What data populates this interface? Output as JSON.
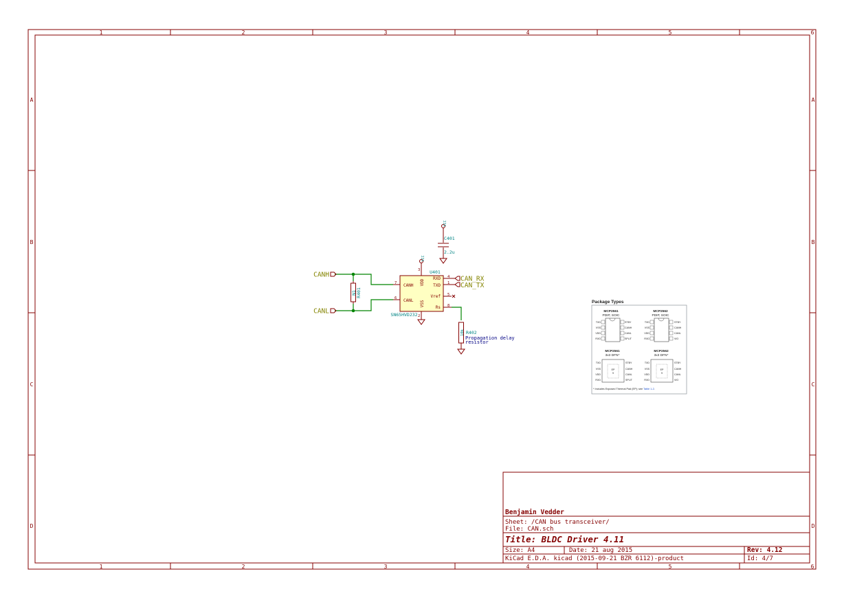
{
  "frame": {
    "columns": [
      "1",
      "2",
      "3",
      "4",
      "5",
      "6"
    ],
    "rows": [
      "A",
      "B",
      "C",
      "D"
    ]
  },
  "schematic": {
    "u401": {
      "ref": "U401",
      "value": "SN65HVD232",
      "pins": {
        "canh": {
          "name": "CANH",
          "num": "7"
        },
        "canl": {
          "name": "CANL",
          "num": "6"
        },
        "vdd": {
          "name": "VDD",
          "num": "3"
        },
        "vss": {
          "name": "VSS",
          "num": "2"
        },
        "rxd": {
          "name": "RXD",
          "num": "4"
        },
        "txd": {
          "name": "TXD",
          "num": "1"
        },
        "vref": {
          "name": "Vref",
          "num": "5"
        },
        "rs": {
          "name": "Rs",
          "num": "8"
        }
      }
    },
    "c401": {
      "ref": "C401",
      "value": "2.2u"
    },
    "r401": {
      "ref": "R401",
      "value": "N1"
    },
    "r402": {
      "ref": "R402",
      "value": "10k",
      "note_line1": "Propagation delay",
      "note_line2": "resistor"
    },
    "labels": {
      "canh": "CANH",
      "canl": "CANL",
      "can_rx": "CAN_RX",
      "can_tx": "CAN_TX"
    },
    "power": {
      "vcc": "VCC"
    }
  },
  "package_types": {
    "title": "Package Types",
    "mcp2561_pdip": {
      "name": "MCP2561",
      "pkg": "PDIP, SOIC",
      "left": [
        "TXD",
        "VSS",
        "VDD",
        "RXD"
      ],
      "right": [
        "STBY",
        "CANH",
        "CANL",
        "SPLIT"
      ]
    },
    "mcp2562_pdip": {
      "name": "MCP2562",
      "pkg": "PDIP, SOIC",
      "left": [
        "TXD",
        "VSS",
        "VDD",
        "RXD"
      ],
      "right": [
        "STBY",
        "CANH",
        "CANL",
        "VIO"
      ]
    },
    "mcp2561_dfn": {
      "name": "MCP2561",
      "pkg": "3x3 DFN*",
      "left": [
        "TXD",
        "VSS",
        "VDD",
        "RXD"
      ],
      "right": [
        "STBY",
        "CANH",
        "CANL",
        "SPLIT"
      ],
      "ep": "EP",
      "ep_num": "9"
    },
    "mcp2562_dfn": {
      "name": "MCP2562",
      "pkg": "3x3 DFN*",
      "left": [
        "TXD",
        "VSS",
        "VDD",
        "RXD"
      ],
      "right": [
        "STBY",
        "CANH",
        "CANL",
        "VIO"
      ],
      "ep": "EP",
      "ep_num": "9"
    },
    "footnote_prefix": "* Includes Exposed Thermal Pad (EP); see ",
    "footnote_link": "Table 1-2",
    "footnote_suffix": "."
  },
  "title_block": {
    "company": "Benjamin Vedder",
    "sheet": "Sheet: /CAN bus transceiver/",
    "file": "File: CAN.sch",
    "title": "Title: BLDC Driver 4.11",
    "size": "Size: A4",
    "date": "Date: 21 aug 2015",
    "rev": "Rev: 4.12",
    "tool": "KiCad E.D.A.  kicad (2015-09-21 BZR 6112)-product",
    "id": "Id: 4/7"
  },
  "colors": {
    "frame": "#840000",
    "wire": "#008400",
    "label": "#848400",
    "reference": "#008484",
    "component_fill": "#ffffc2",
    "note": "#000084"
  }
}
